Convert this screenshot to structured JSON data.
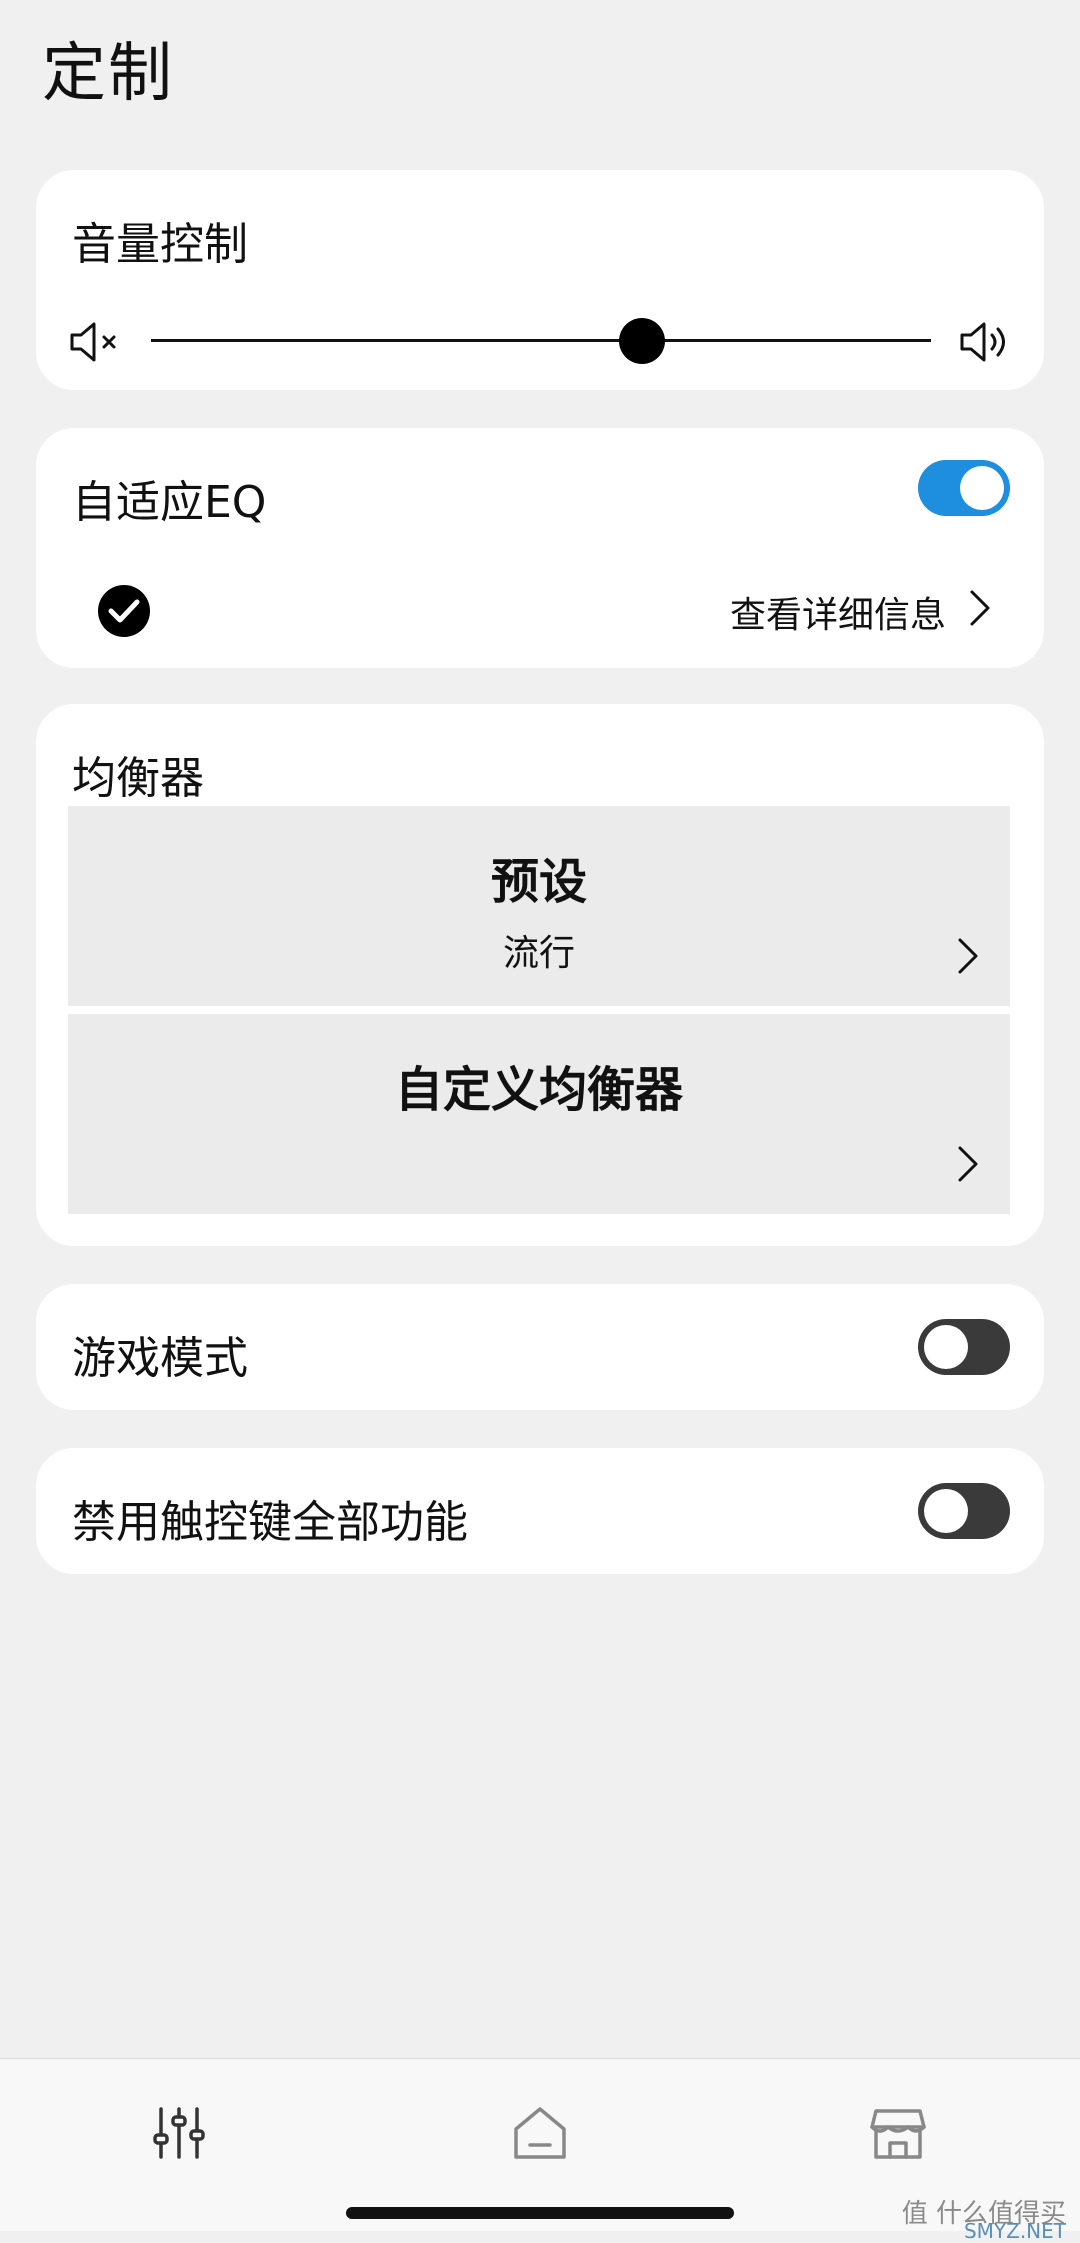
{
  "page": {
    "title": "定制"
  },
  "volume": {
    "title": "音量控制",
    "level": 0.63
  },
  "adaptive_eq": {
    "title": "自适应EQ",
    "enabled": true,
    "details_label": "查看详细信息"
  },
  "equalizer": {
    "title": "均衡器",
    "preset": {
      "title": "预设",
      "value": "流行"
    },
    "custom": {
      "title": "自定义均衡器"
    }
  },
  "game_mode": {
    "title": "游戏模式",
    "enabled": false
  },
  "touch_controls": {
    "title": "禁用触控键全部功能",
    "enabled": false
  },
  "bottom_nav": {
    "items": [
      "equalizer-icon",
      "home-icon",
      "store-icon"
    ]
  },
  "watermark": {
    "text": "值 什么值得买",
    "sub": "SMYZ.NET"
  },
  "colors": {
    "accent": "#1e8ede",
    "toggle_off": "#3a3a3a",
    "background": "#f0f0f0"
  }
}
